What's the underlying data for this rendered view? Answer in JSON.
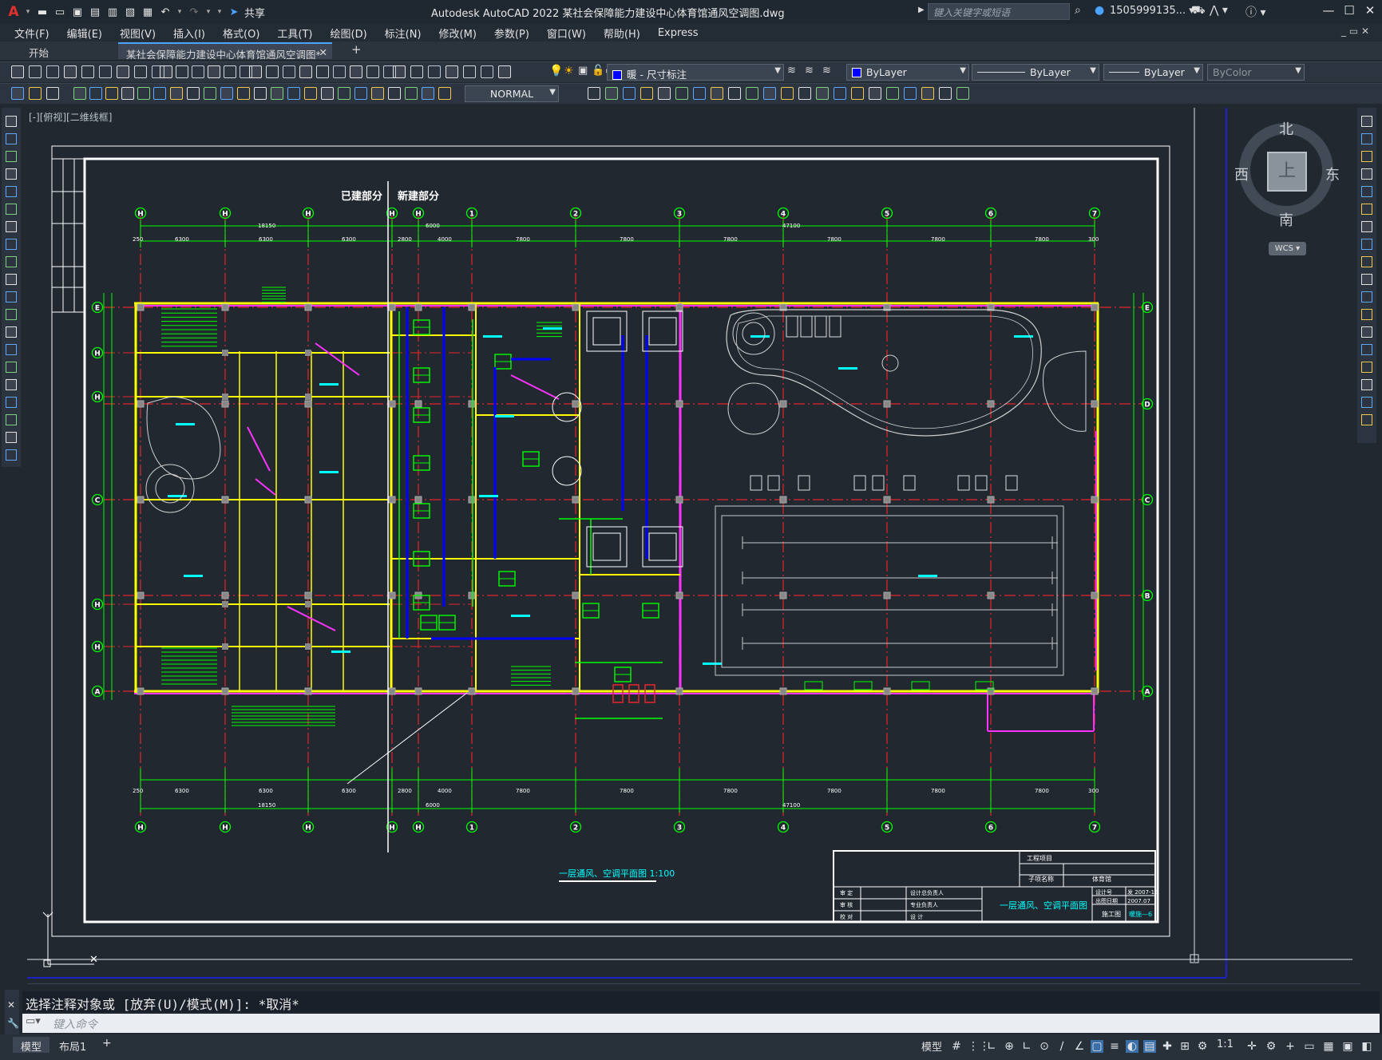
{
  "app": {
    "title": "Autodesk AutoCAD 2022    某社会保障能力建设中心体育馆通风空调图.dwg",
    "search_placeholder": "键入关键字或短语",
    "user": "1505999135... ▾",
    "share_label": "共享",
    "logo_letter": "A"
  },
  "menu": [
    "文件(F)",
    "编辑(E)",
    "视图(V)",
    "插入(I)",
    "格式(O)",
    "工具(T)",
    "绘图(D)",
    "标注(N)",
    "修改(M)",
    "参数(P)",
    "窗口(W)",
    "帮助(H)",
    "Express"
  ],
  "tabs": {
    "start": "开始",
    "doc": "某社会保障能力建设中心体育馆通风空调图*",
    "close": "✕",
    "add": "+"
  },
  "properties": {
    "layer": "暖 - 尺寸标注",
    "color": "ByLayer",
    "linetype": "ByLayer",
    "lineweight": "ByLayer",
    "plotstyle": "ByColor",
    "textstyle": "NORMAL"
  },
  "viewport": {
    "label": "[-][俯视][二维线框]",
    "viewcube": {
      "north": "北",
      "south": "南",
      "east": "东",
      "west": "西",
      "top": "上",
      "wcs": "WCS ▾"
    }
  },
  "drawing": {
    "existing_label": "已建部分",
    "new_label": "新建部分",
    "grid_cols_top": [
      "H",
      "H",
      "H",
      "H",
      "H",
      "1",
      "2",
      "3",
      "4",
      "5",
      "6",
      "7"
    ],
    "grid_rows_left": [
      "E",
      "H",
      "H",
      "C",
      "H",
      "H",
      "A"
    ],
    "grid_rows_right": [
      "E",
      "D",
      "C",
      "B",
      "A"
    ],
    "dims_top_seg": [
      "250",
      "6300",
      "6300",
      "6300",
      "2800",
      "4000",
      "7800",
      "7800",
      "7800",
      "7800",
      "7800",
      "7800",
      "300"
    ],
    "dims_top_total": [
      "18150",
      "6000",
      "47100"
    ],
    "dims_bottom_seg": [
      "250",
      "6300",
      "6300",
      "6300",
      "2800",
      "4000",
      "7800",
      "7800",
      "7800",
      "7800",
      "7800",
      "7800",
      "300"
    ],
    "dims_bottom_total": [
      "18150",
      "6000",
      "47100"
    ],
    "plan_title": "一层通风、空调平面图  1:100",
    "titleblock": {
      "project": "工程项目",
      "subproject": "子项名称",
      "subproject_value": "体育馆",
      "drawing_name": "一层通风、空调平面图",
      "design_no_label": "设计号",
      "design_no": "发 2007-15",
      "date_label": "出图日期",
      "date": "2007.07",
      "stage": "施工图",
      "sheet": "暖施—6",
      "roles": [
        "审  定",
        "审  核",
        "校  对"
      ],
      "resp": [
        "设计总负责人",
        "专业负责人",
        "设  计"
      ]
    }
  },
  "command": {
    "history": "选择注释对象或 [放弃(U)/模式(M)]: *取消*",
    "placeholder": "键入命令"
  },
  "status": {
    "model_tab": "模型",
    "layout_tab": "布局1",
    "add": "+",
    "model_btn": "模型",
    "scale": "1:1"
  },
  "colors": {
    "grid_red": "#e8252a",
    "wall_yellow": "#ffff00",
    "wall_magenta": "#ff33ff",
    "duct_green": "#00ff00",
    "text_cyan": "#00ffff",
    "blue": "#0000ff",
    "white": "#ffffff"
  }
}
